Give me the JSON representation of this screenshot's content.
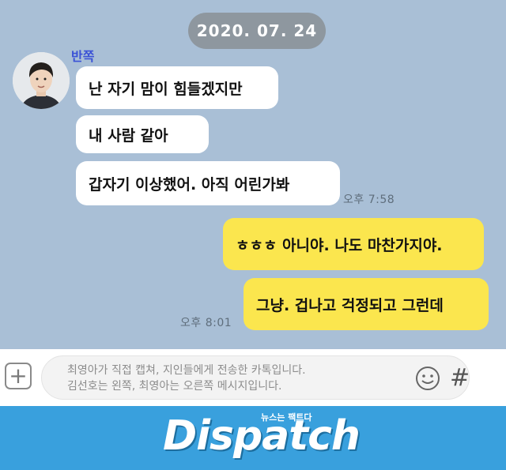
{
  "chat": {
    "date": "2020. 07. 24",
    "sender": "반쪽",
    "incoming": [
      "난 자기 맘이 힘들겠지만",
      "내 사람 같아",
      "갑자기 이상했어. 아직 어린가봐"
    ],
    "incoming_time": "오후 7:58",
    "outgoing": [
      "ㅎㅎㅎ 아니야. 나도 마찬가지야.",
      "그냥. 겁나고 걱정되고 그런데"
    ],
    "outgoing_time": "오후 8:01"
  },
  "input": {
    "placeholder_line1": "최영아가 직접 캡쳐, 지인들에게 전송한 카톡입니다.",
    "placeholder_line2": "김선호는 왼쪽, 최영아는 오른쪽 메시지입니다.",
    "plus_icon": "plus-icon",
    "emoji_icon": "emoji-icon",
    "hash_symbol": "#"
  },
  "branding": {
    "logo": "Dispatch",
    "tagline": "뉴스는 팩트다",
    "band_color": "#39a0dd"
  },
  "colors": {
    "chat_bg": "#a9bfd6",
    "out_bubble": "#fbe64e",
    "in_bubble": "#ffffff",
    "sender_name": "#3b52d6"
  }
}
